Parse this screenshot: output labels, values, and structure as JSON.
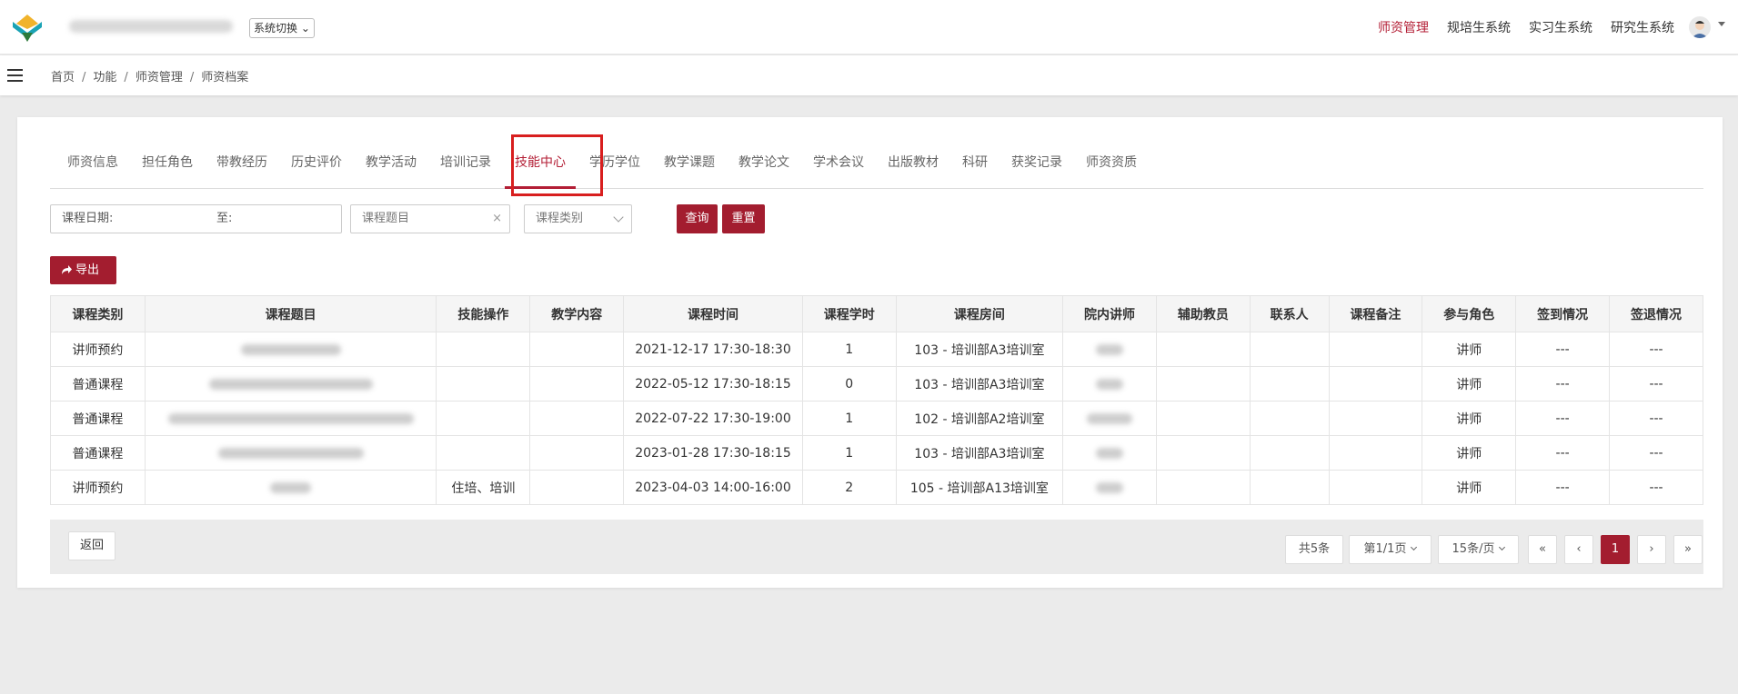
{
  "header": {
    "system_switch": "系统切换",
    "nav": [
      "师资管理",
      "规培生系统",
      "实习生系统",
      "研究生系统"
    ],
    "accent": "#b31e35"
  },
  "breadcrumb": [
    "首页",
    "功能",
    "师资管理",
    "师资档案"
  ],
  "tabs": [
    "师资信息",
    "担任角色",
    "带教经历",
    "历史评价",
    "教学活动",
    "培训记录",
    "技能中心",
    "学历学位",
    "教学课题",
    "教学论文",
    "学术会议",
    "出版教材",
    "科研",
    "获奖记录",
    "师资资质"
  ],
  "active_tab": "技能中心",
  "filters": {
    "date_label": "课程日期:",
    "date_to": "至:",
    "title_placeholder": "课程题目",
    "clear_icon": "×",
    "type_placeholder": "课程类别",
    "query": "查询",
    "reset": "重置"
  },
  "export_label": "导出",
  "table": {
    "headers": [
      "课程类别",
      "课程题目",
      "技能操作",
      "教学内容",
      "课程时间",
      "课程学时",
      "课程房间",
      "院内讲师",
      "辅助教员",
      "联系人",
      "课程备注",
      "参与角色",
      "签到情况",
      "签退情况"
    ],
    "rows": [
      {
        "type": "讲师预约",
        "skill": "",
        "content": "",
        "time": "2021-12-17 17:30-18:30",
        "hours": "1",
        "room": "103 - 培训部A3培训室",
        "assist": "",
        "contact": "",
        "note": "",
        "role": "讲师",
        "signin": "---",
        "signout": "---"
      },
      {
        "type": "普通课程",
        "skill": "",
        "content": "",
        "time": "2022-05-12 17:30-18:15",
        "hours": "0",
        "room": "103 - 培训部A3培训室",
        "assist": "",
        "contact": "",
        "note": "",
        "role": "讲师",
        "signin": "---",
        "signout": "---"
      },
      {
        "type": "普通课程",
        "skill": "",
        "content": "",
        "time": "2022-07-22 17:30-19:00",
        "hours": "1",
        "room": "102 - 培训部A2培训室",
        "assist": "",
        "contact": "",
        "note": "",
        "role": "讲师",
        "signin": "---",
        "signout": "---"
      },
      {
        "type": "普通课程",
        "skill": "",
        "content": "",
        "time": "2023-01-28 17:30-18:15",
        "hours": "1",
        "room": "103 - 培训部A3培训室",
        "assist": "",
        "contact": "",
        "note": "",
        "role": "讲师",
        "signin": "---",
        "signout": "---"
      },
      {
        "type": "讲师预约",
        "skill": "住培、培训",
        "content": "",
        "time": "2023-04-03 14:00-16:00",
        "hours": "2",
        "room": "105 - 培训部A13培训室",
        "assist": "",
        "contact": "",
        "note": "",
        "role": "讲师",
        "signin": "---",
        "signout": "---"
      }
    ]
  },
  "footer": {
    "back": "返回",
    "total": "共5条",
    "page_info": "第1/1页",
    "page_size": "15条/页",
    "first": "«",
    "prev": "‹",
    "current": "1",
    "next": "›",
    "last": "»"
  }
}
